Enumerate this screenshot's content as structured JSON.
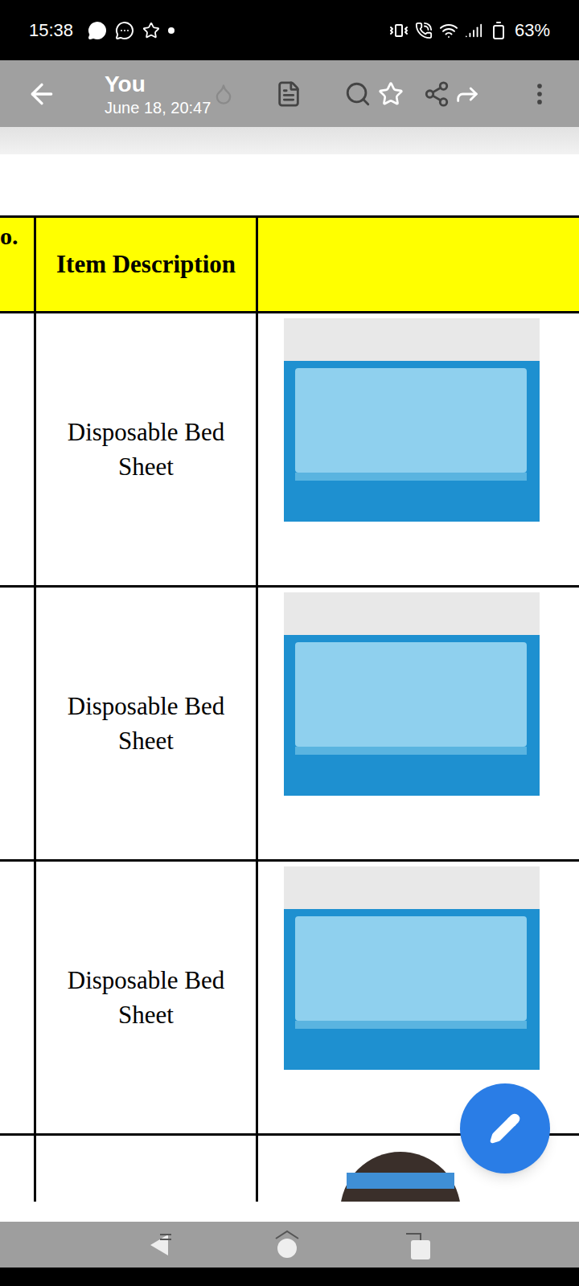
{
  "status_bar": {
    "time": "15:38",
    "battery": "63%"
  },
  "toolbar": {
    "title": "You",
    "subtitle": "June 18, 20:47"
  },
  "table": {
    "columns": [
      "o.",
      "Item Description",
      ""
    ],
    "rows": [
      {
        "description": "Disposable Bed Sheet"
      },
      {
        "description": "Disposable Bed Sheet"
      },
      {
        "description": "Disposable Bed Sheet"
      },
      {
        "description": ""
      }
    ]
  }
}
